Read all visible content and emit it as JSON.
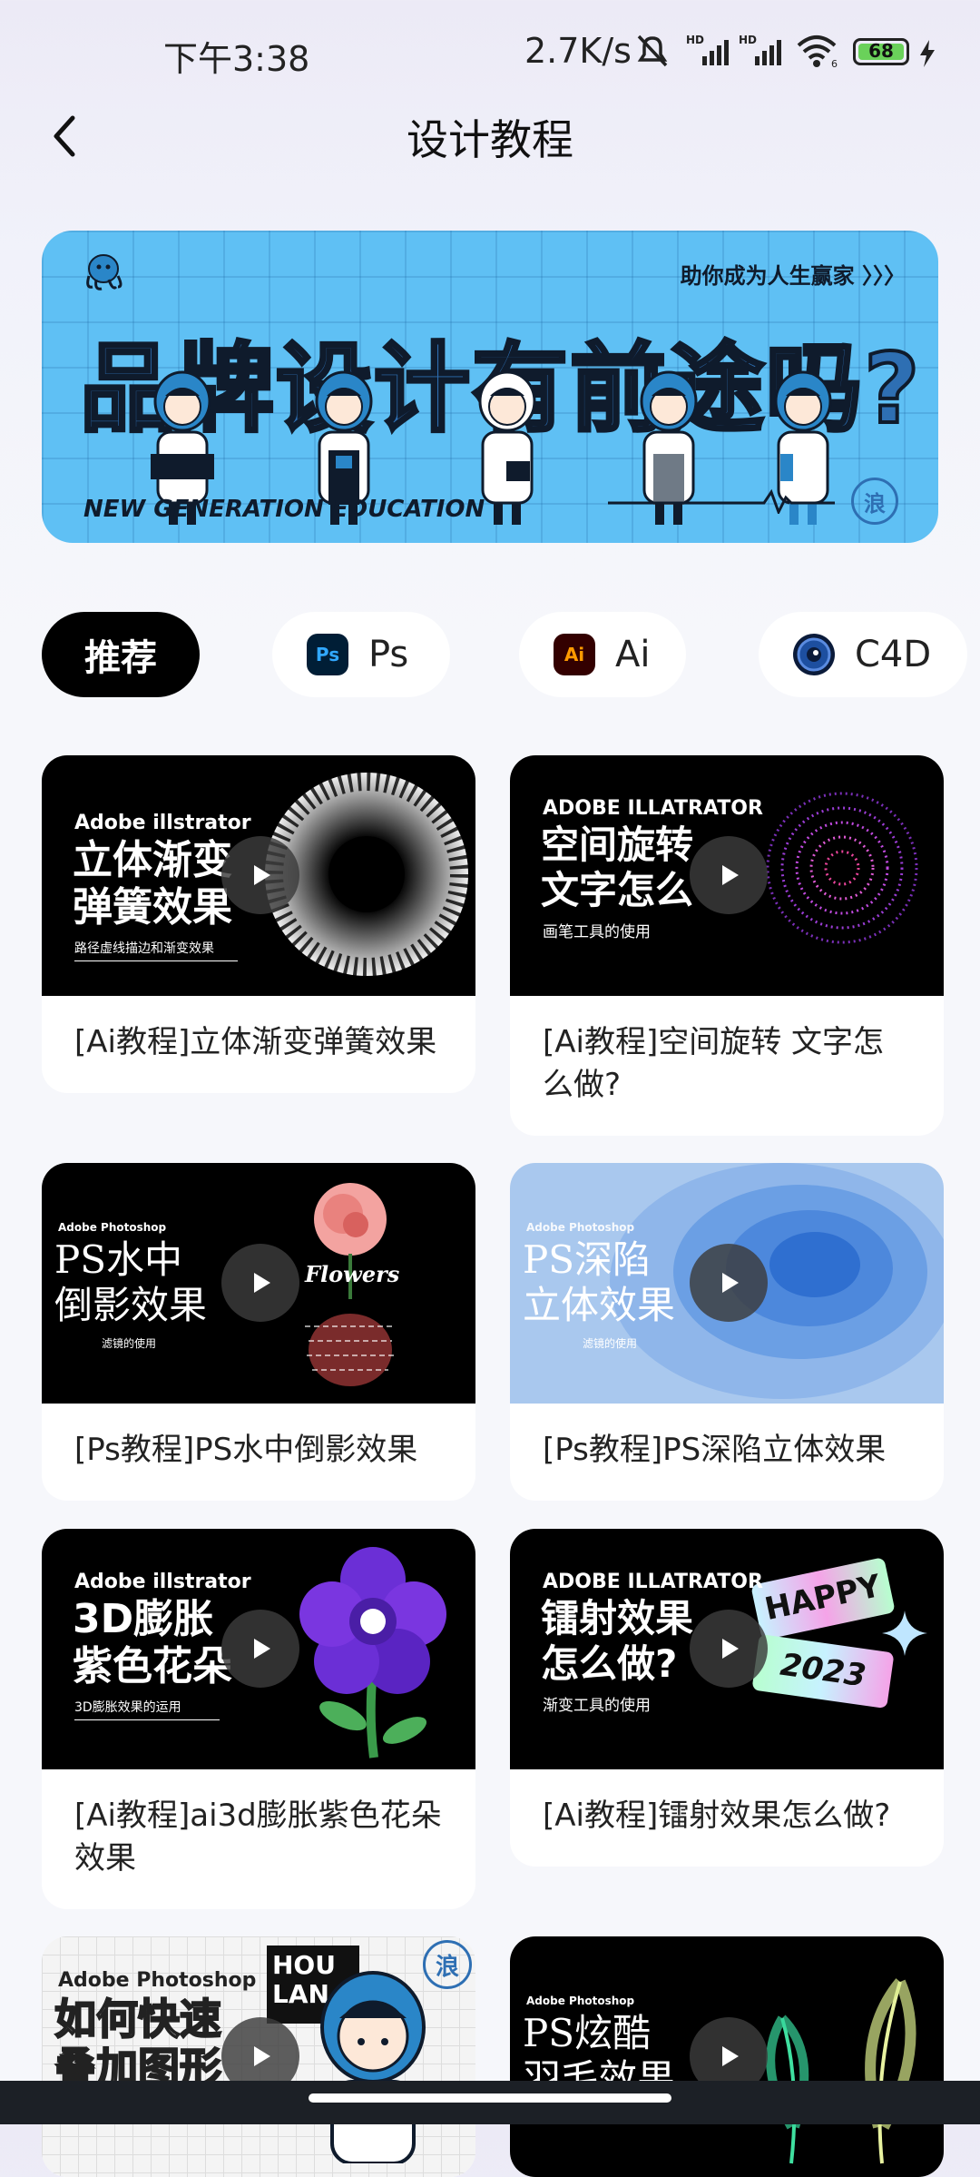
{
  "status_bar": {
    "time": "下午3:38",
    "speed": "2.7K/s",
    "battery": "68"
  },
  "header": {
    "title": "设计教程"
  },
  "banner": {
    "slogan": "助你成为人生赢家 〉〉〉",
    "headline": "品牌设计有前途吗?",
    "footer": "NEW GENERATION EDUCATION",
    "seal": "浪"
  },
  "tabs": [
    {
      "label": "推荐",
      "active": true
    },
    {
      "label": "Ps",
      "icon": "Ps"
    },
    {
      "label": "Ai",
      "icon": "Ai"
    },
    {
      "label": "C4D",
      "icon": "c4d"
    }
  ],
  "cards": [
    {
      "caption": "[Ai教程]立体渐变弹簧效果",
      "thumb": {
        "brand": "Adobe illstrator",
        "line1": "立体渐变",
        "line2": "弹簧效果",
        "sub": "路径虚线描边和渐变效果"
      }
    },
    {
      "caption": "[Ai教程]空间旋转 文字怎么做?",
      "thumb": {
        "brand": "ADOBE ILLATRATOR",
        "line1": "空间旋转",
        "line2": "文字怎么",
        "sub": "画笔工具的使用"
      }
    },
    {
      "caption": "[Ps教程]PS水中倒影效果",
      "thumb": {
        "brand": "Adobe Photoshop",
        "line1": "PS水中",
        "line2": "倒影效果",
        "sub": "滤镜的使用",
        "deco": "Flowers"
      }
    },
    {
      "caption": "[Ps教程]PS深陷立体效果",
      "thumb": {
        "brand": "Adobe Photoshop",
        "line1": "PS深陷",
        "line2": "立体效果",
        "sub": "滤镜的使用"
      }
    },
    {
      "caption": "[Ai教程]ai3d膨胀紫色花朵效果",
      "thumb": {
        "brand": "Adobe illstrator",
        "line1": "3D膨胀",
        "line2": "紫色花朵",
        "sub": "3D膨胀效果的运用"
      }
    },
    {
      "caption": "[Ai教程]镭射效果怎么做?",
      "thumb": {
        "brand": "ADOBE ILLATRATOR",
        "line1": "镭射效果",
        "line2": "怎么做?",
        "sub": "渐变工具的使用",
        "deco1": "HAPPY",
        "deco2": "2023"
      }
    },
    {
      "thumb": {
        "brand": "Adobe Photoshop",
        "line1": "如何快速",
        "line2": "叠加图形",
        "logo": "HOU LAN",
        "seal": "浪"
      }
    },
    {
      "thumb": {
        "brand": "Adobe Photoshop",
        "line1": "PS炫酷",
        "line2": "羽毛效果"
      }
    }
  ]
}
